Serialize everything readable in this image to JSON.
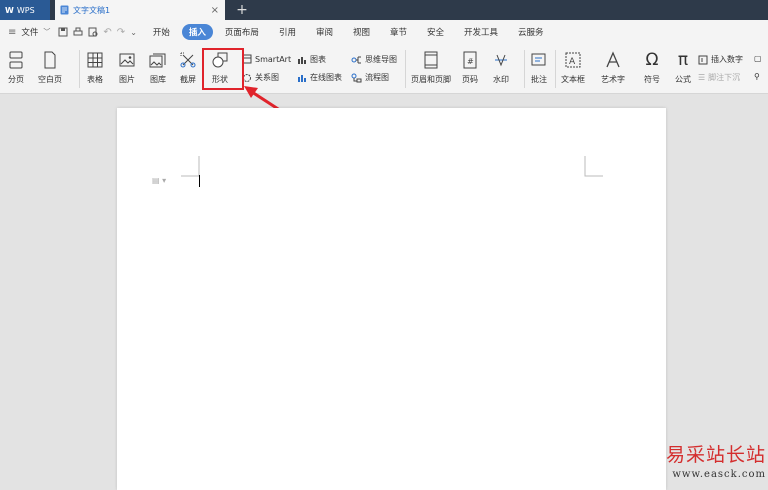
{
  "titlebar": {
    "app_tab_label": "WPS",
    "doc_tab_label": "文字文稿1",
    "new_tab_symbol": "+"
  },
  "menubar": {
    "file_label": "文件",
    "items": [
      "开始",
      "插入",
      "页面布局",
      "引用",
      "审阅",
      "视图",
      "章节",
      "安全",
      "开发工具",
      "云服务"
    ],
    "active_item": "插入"
  },
  "ribbon": {
    "page_break": "分页",
    "blank_page": "空白页",
    "table": "表格",
    "picture": "图片",
    "gallery": "图库",
    "screenshot": "截屏",
    "shape": "形状",
    "smartart": "SmartArt",
    "chart": "图表",
    "mindmap": "思维导图",
    "relation": "关系图",
    "online_chart": "在线图表",
    "flowchart": "流程图",
    "header_footer": "页眉和页脚",
    "page_number": "页码",
    "watermark": "水印",
    "comment": "批注",
    "textbox": "文本框",
    "wordart": "艺术字",
    "symbol": "符号",
    "formula": "公式",
    "insert_number": "插入数字",
    "footnote": "脚注下沉"
  },
  "watermark": {
    "line1": "易采站长站",
    "line2": "www.easck.com"
  },
  "colors": {
    "accent": "#4a86d6",
    "highlight": "#e0232b",
    "titlebar": "#2e3a4a"
  }
}
